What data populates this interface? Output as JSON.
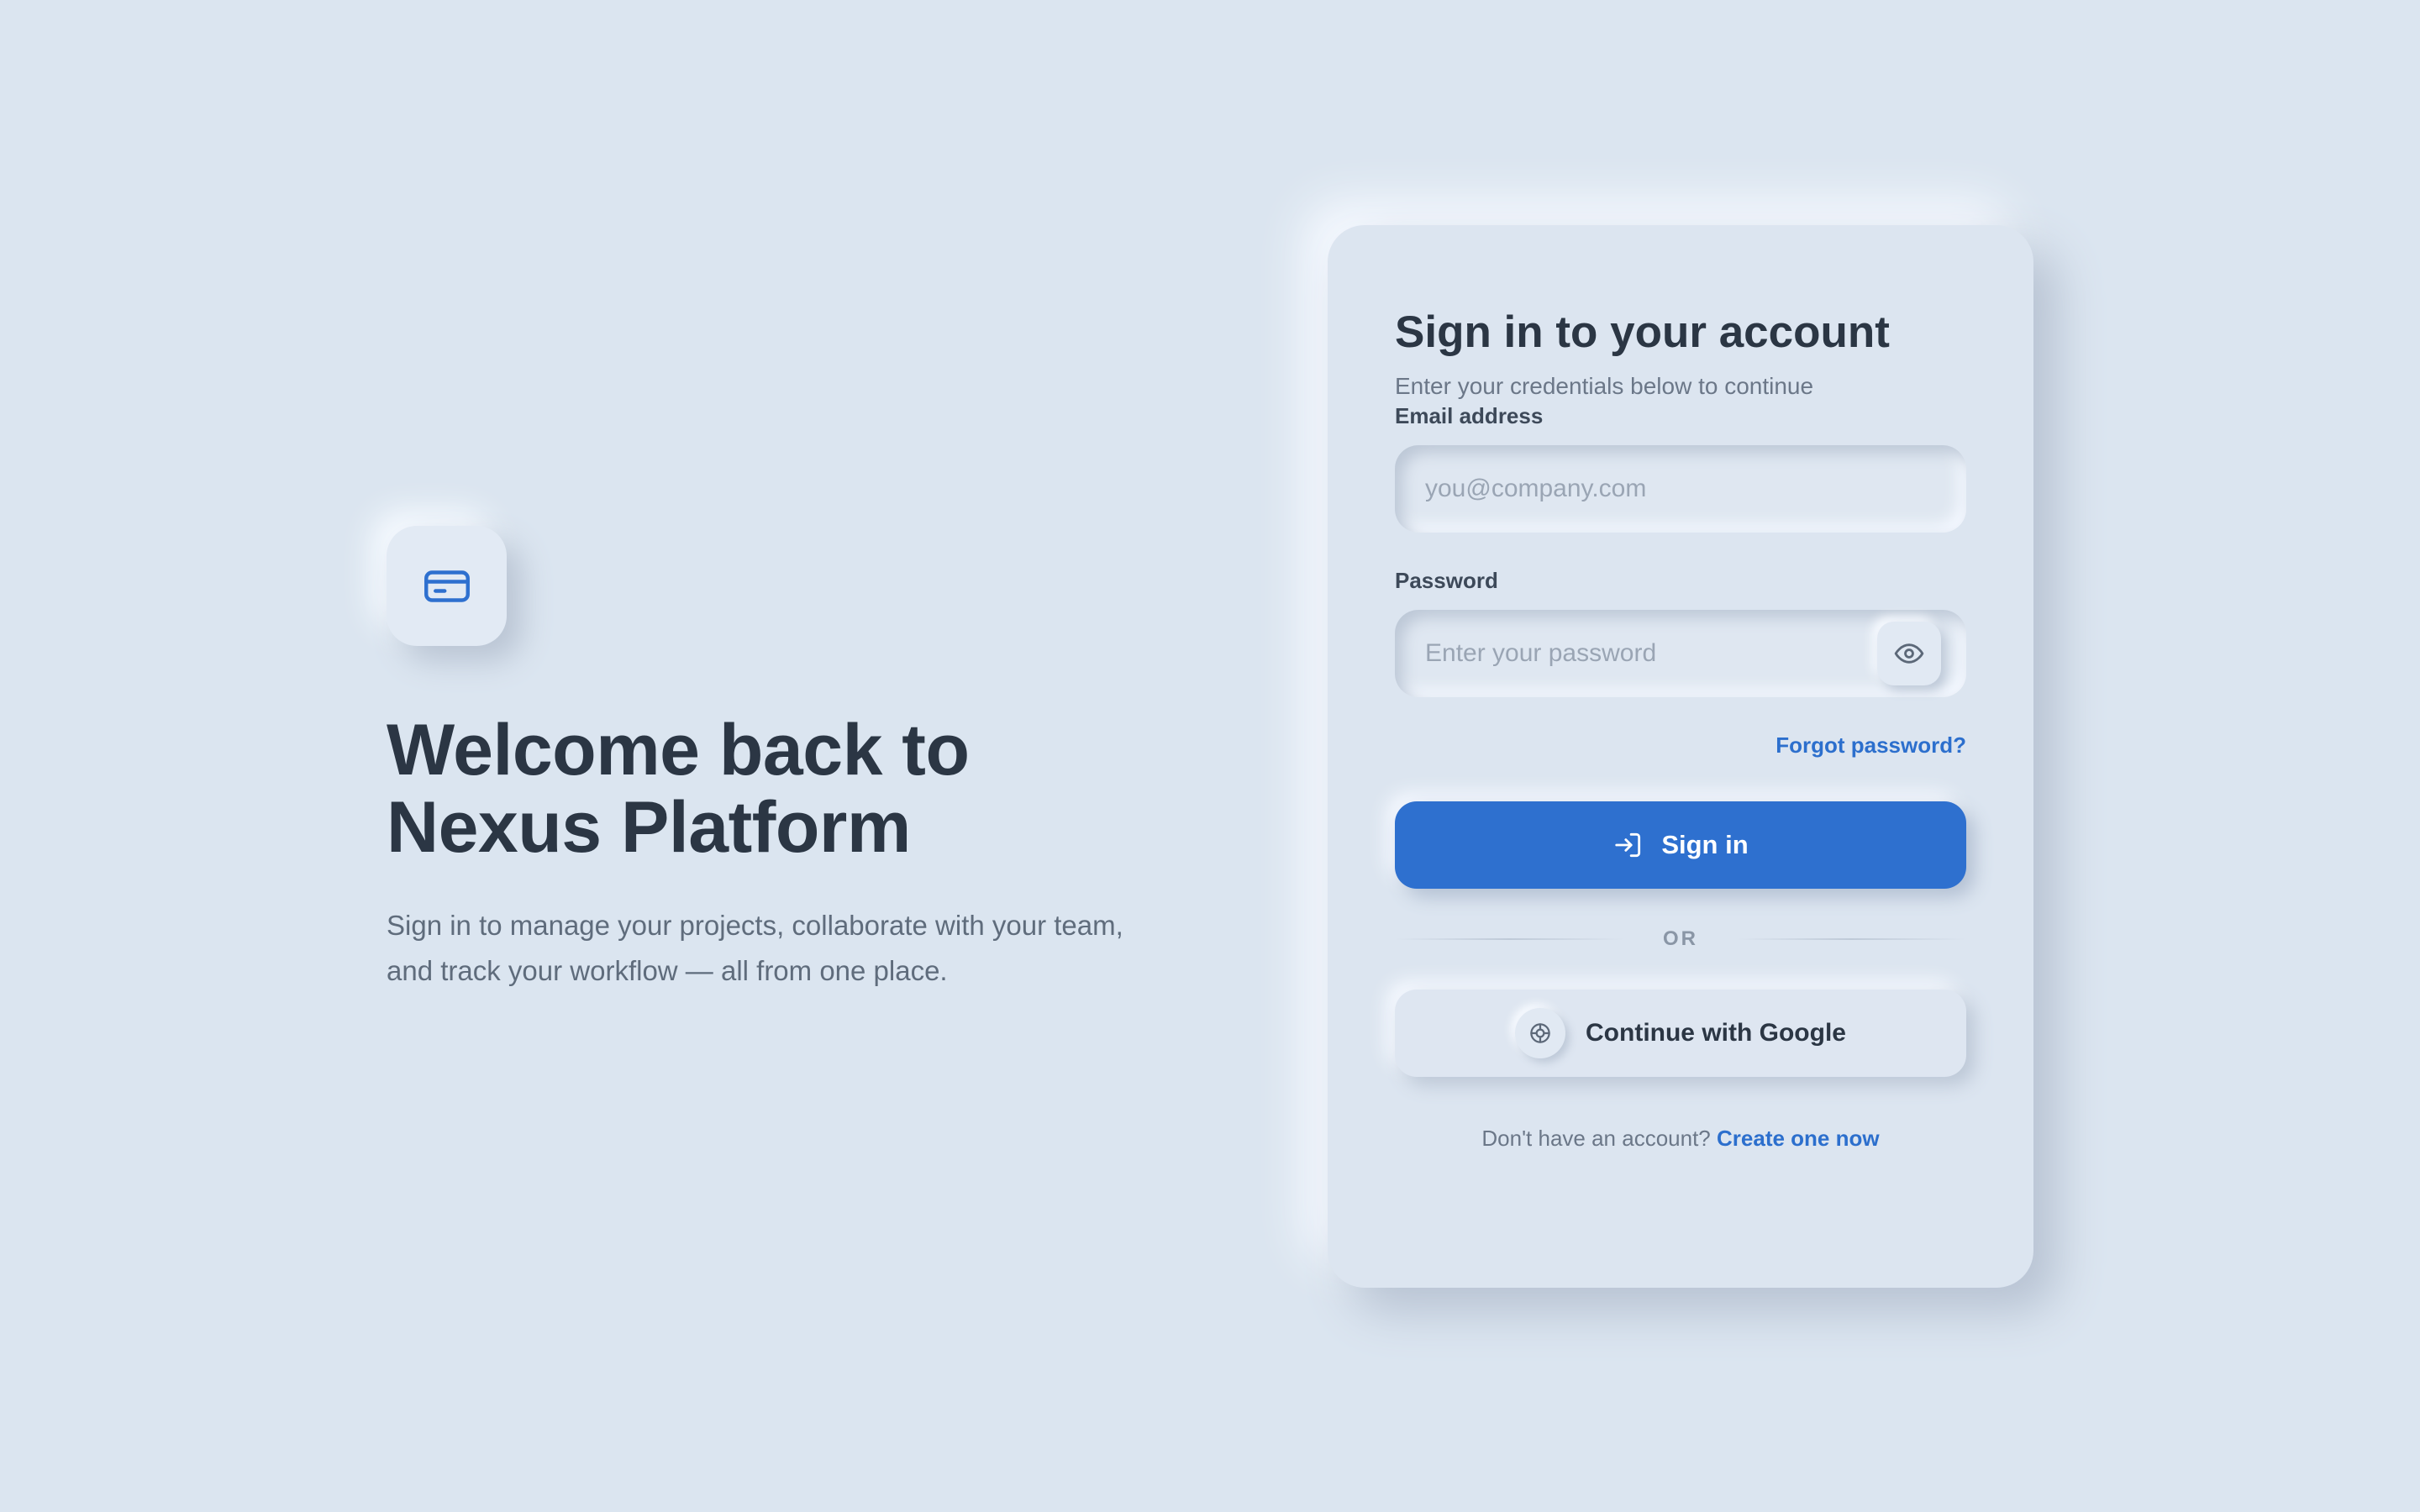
{
  "hero": {
    "logo_icon": "credit-card-icon",
    "title_line1": "Welcome back to",
    "title_line2": "Nexus Platform",
    "subtitle_line1": "Sign in to manage your projects, collaborate with your team,",
    "subtitle_line2": "and track your workflow — all from one place."
  },
  "card": {
    "title": "Sign in to your account",
    "subtitle": "Enter your credentials below to continue",
    "email": {
      "label": "Email address",
      "placeholder": "you@company.com",
      "value": ""
    },
    "password": {
      "label": "Password",
      "placeholder": "Enter your password",
      "value": "",
      "toggle_icon": "eye-icon"
    },
    "forgot_link": "Forgot password?",
    "sign_in_button": "Sign in",
    "sign_in_icon": "login-arrow-icon",
    "divider_text": "OR",
    "google_button": "Continue with Google",
    "google_icon": "google-target-icon",
    "signup_prompt": "Don't have an account?",
    "signup_link": "Create one now"
  },
  "colors": {
    "background": "#dbe5f0",
    "accent": "#2e70cf",
    "heading": "#2b3644",
    "muted": "#6b7788"
  }
}
